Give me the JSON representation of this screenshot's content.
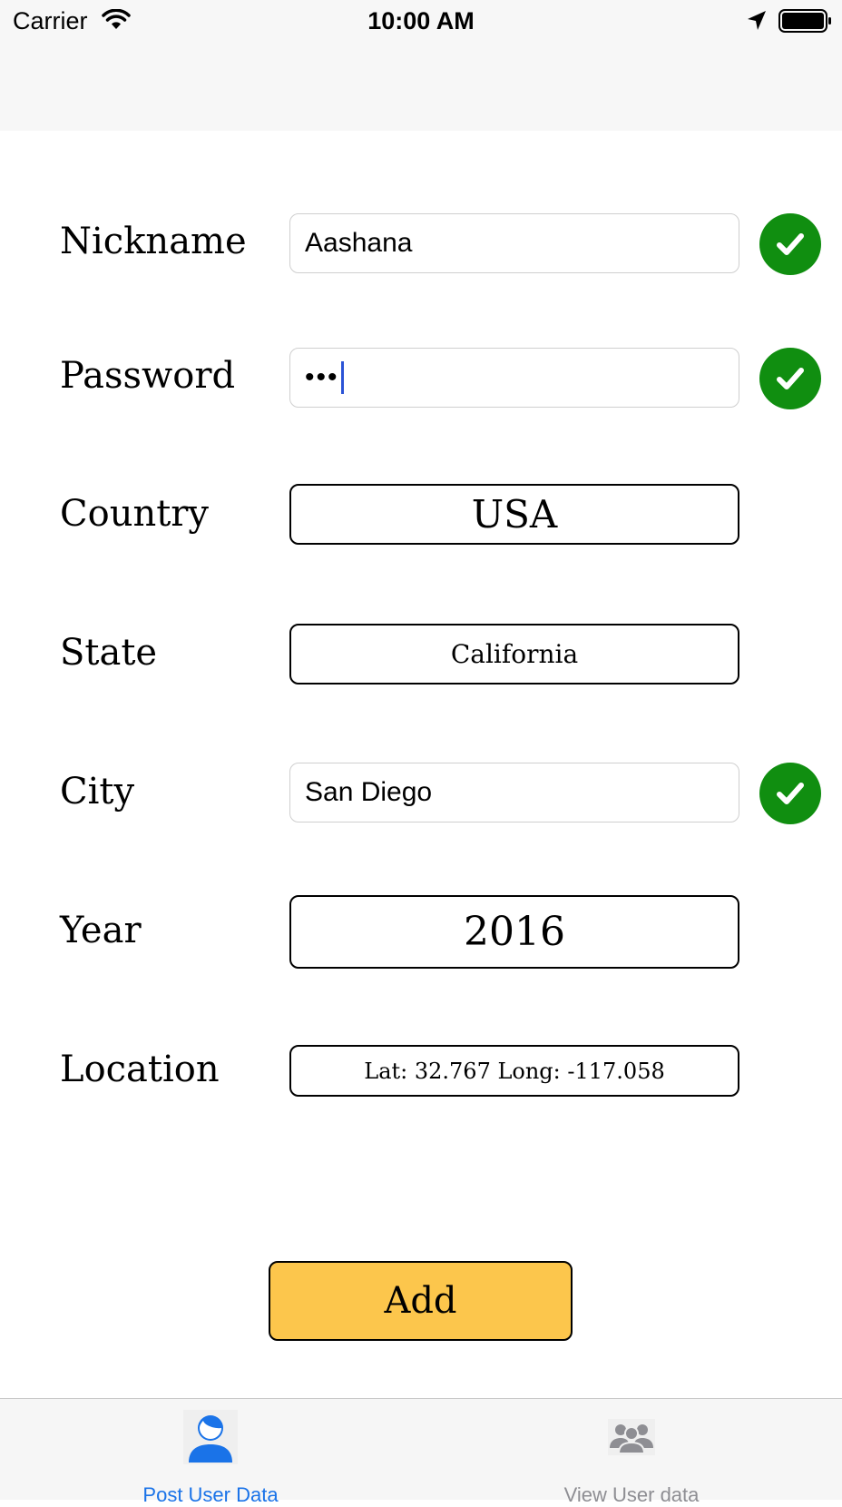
{
  "status_bar": {
    "carrier": "Carrier",
    "time": "10:00 AM"
  },
  "form": {
    "nickname": {
      "label": "Nickname",
      "value": "Aashana",
      "valid": true
    },
    "password": {
      "label": "Password",
      "masked_value": "•••",
      "valid": true
    },
    "country": {
      "label": "Country",
      "value": "USA"
    },
    "state": {
      "label": "State",
      "value": "California"
    },
    "city": {
      "label": "City",
      "value": "San Diego",
      "valid": true
    },
    "year": {
      "label": "Year",
      "value": "2016"
    },
    "location": {
      "label": "Location",
      "value": "Lat: 32.767 Long: -117.058"
    }
  },
  "add_button_label": "Add",
  "tab_bar": {
    "tabs": [
      {
        "label": "Post User Data",
        "icon": "person-icon",
        "selected": true
      },
      {
        "label": "View User data",
        "icon": "group-icon",
        "selected": false
      }
    ]
  },
  "colors": {
    "valid_check": "#108e10",
    "add_button": "#fcc64c",
    "tab_selected": "#1a73e8",
    "tab_unselected": "#8e8e93",
    "caret": "#2b53d6"
  }
}
